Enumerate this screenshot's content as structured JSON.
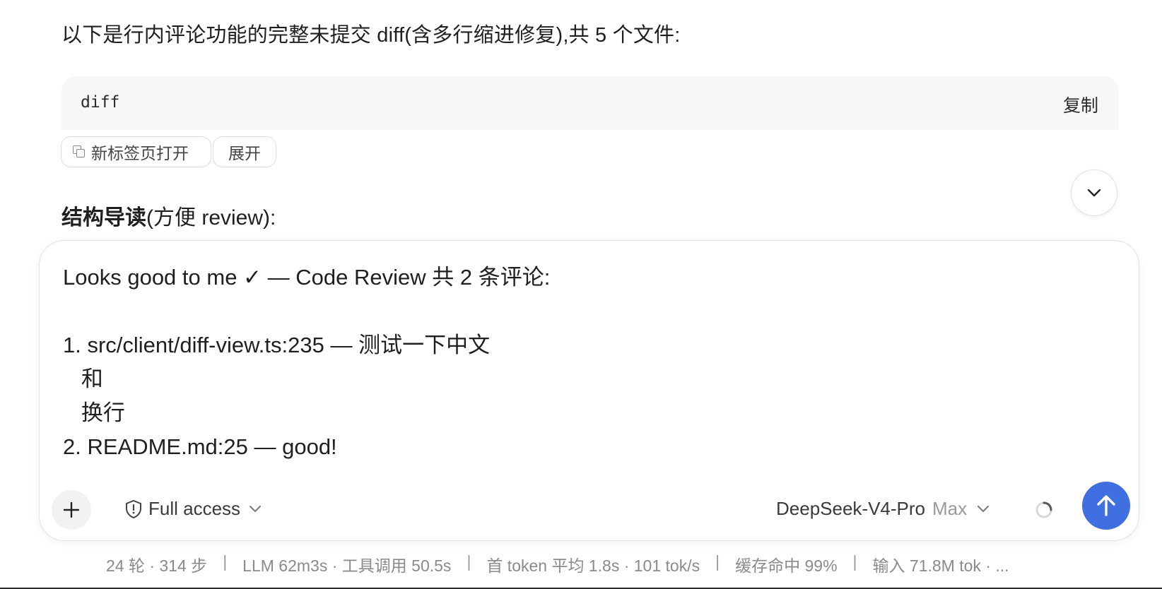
{
  "intro_text": "以下是行内评论功能的完整未提交 diff(含多行缩进修复),共 5 个文件:",
  "code_block": {
    "language": "diff",
    "copy_label": "复制"
  },
  "actions": {
    "open_new_tab_label": "新标签页打开",
    "expand_label": "展开"
  },
  "section": {
    "bold": "结构导读",
    "rest": "(方便 review):"
  },
  "composer": {
    "text": "Looks good to me ✓ — Code Review 共 2 条评论:\n\n1. src/client/diff-view.ts:235 — 测试一下中文\n   和\n   换行\n2. README.md:25 — good!",
    "access_label": "Full access",
    "model_name": "DeepSeek-V4-Pro",
    "model_tier": "Max"
  },
  "status_bar": {
    "items": [
      "24 轮 · 314 步",
      "LLM 62m3s · 工具调用 50.5s",
      "首 token 平均 1.8s · 101 tok/s",
      "缓存命中 99%",
      "输入 71.8M tok · ..."
    ],
    "separator": "|"
  },
  "colors": {
    "send_button": "#3f6fe0",
    "code_bg": "#f7f7f8"
  },
  "icons": [
    "copy-window-icon",
    "chevron-down-icon",
    "plus-icon",
    "shield-icon",
    "spinner-icon",
    "arrow-up-icon"
  ]
}
